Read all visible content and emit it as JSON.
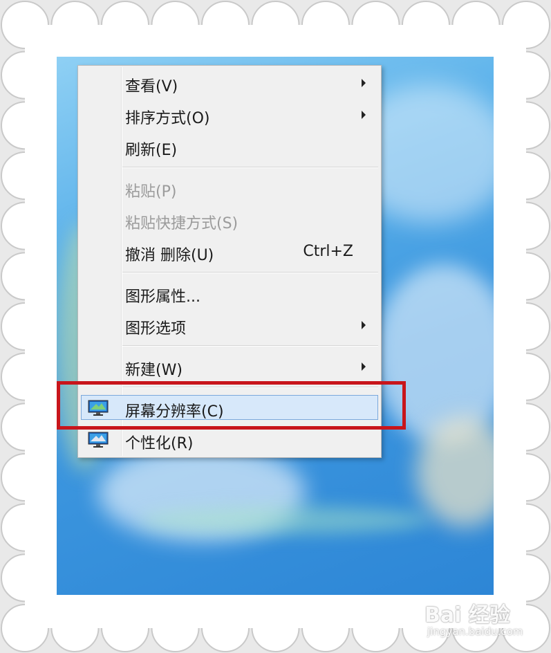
{
  "menu": {
    "items": [
      {
        "label": "查看(V)",
        "submenu": true
      },
      {
        "label": "排序方式(O)",
        "submenu": true
      },
      {
        "label": "刷新(E)"
      },
      {
        "label": "粘贴(P)",
        "disabled": true
      },
      {
        "label": "粘贴快捷方式(S)",
        "disabled": true
      },
      {
        "label": "撤消 删除(U)",
        "shortcut": "Ctrl+Z"
      },
      {
        "label": "图形属性..."
      },
      {
        "label": "图形选项",
        "submenu": true
      },
      {
        "label": "新建(W)",
        "submenu": true
      },
      {
        "label": "屏幕分辨率(C)",
        "icon": "monitor-icon",
        "highlighted": true
      },
      {
        "label": "个性化(R)",
        "icon": "monitor-icon"
      }
    ]
  },
  "watermark": {
    "logo": "Bai 经验",
    "url": "jingyan.baidu.com"
  },
  "colors": {
    "highlight_box": "#c8151b",
    "menu_highlight": "#d7e8fa",
    "desktop": "#3b95de"
  }
}
